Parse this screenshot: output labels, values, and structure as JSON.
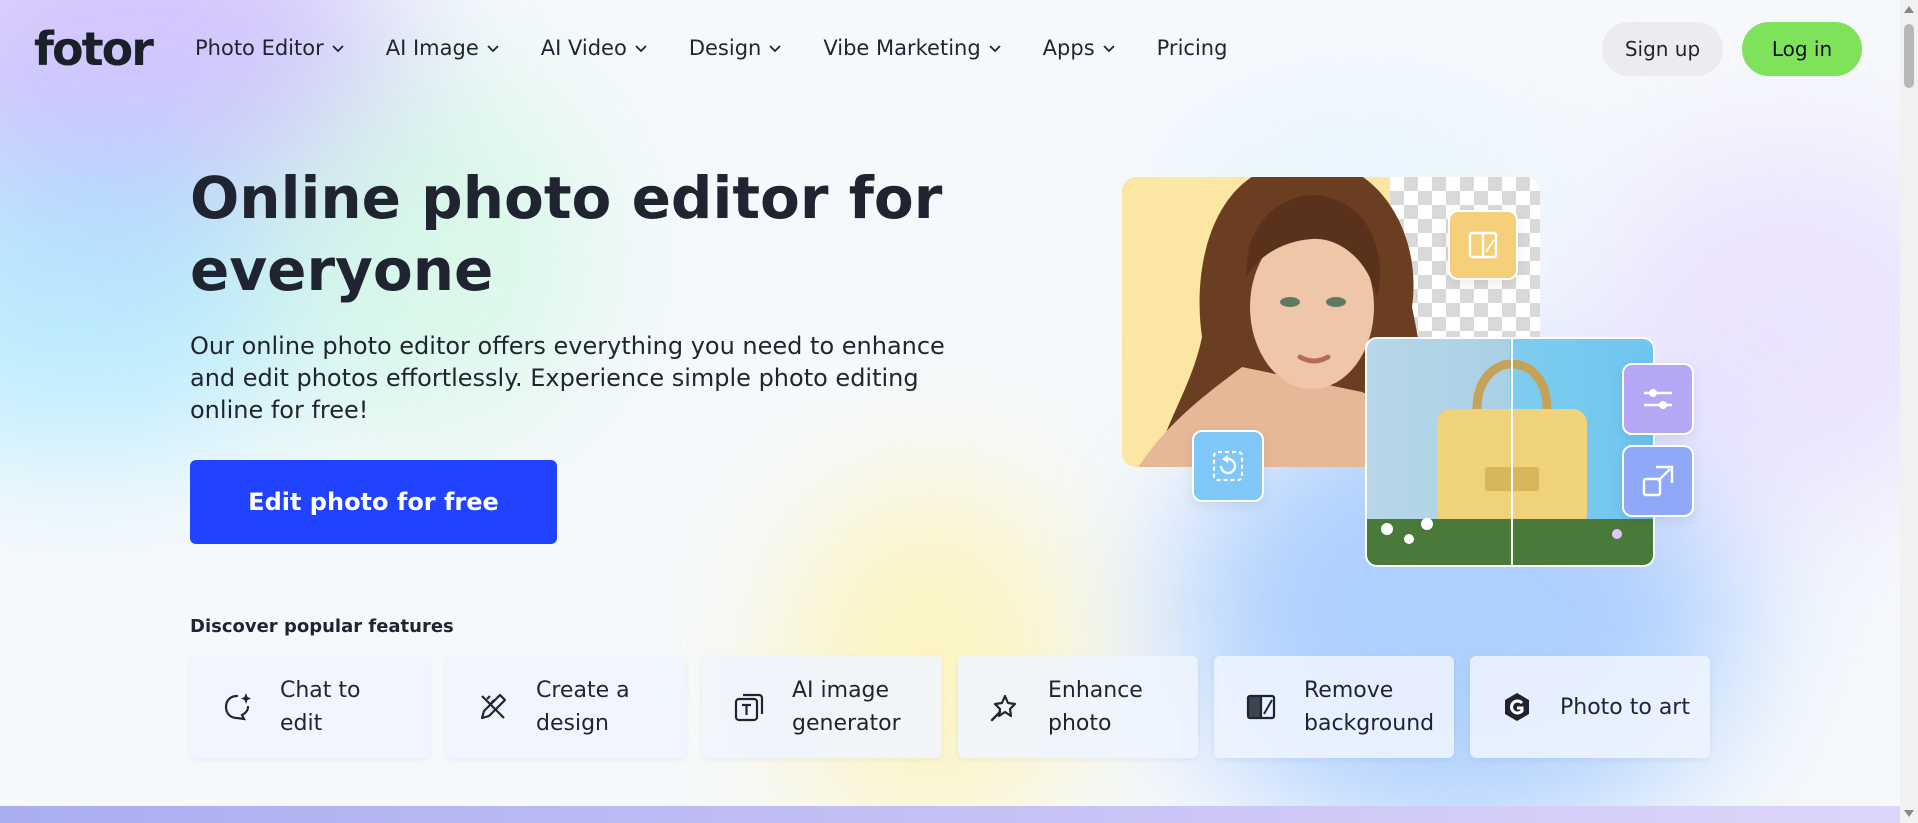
{
  "brand": {
    "logo": "fotor"
  },
  "nav": {
    "items": [
      {
        "label": "Photo Editor",
        "has_dropdown": true
      },
      {
        "label": "AI Image",
        "has_dropdown": true
      },
      {
        "label": "AI Video",
        "has_dropdown": true
      },
      {
        "label": "Design",
        "has_dropdown": true
      },
      {
        "label": "Vibe Marketing",
        "has_dropdown": true
      },
      {
        "label": "Apps",
        "has_dropdown": true
      },
      {
        "label": "Pricing",
        "has_dropdown": false
      }
    ],
    "signup_label": "Sign up",
    "login_label": "Log in"
  },
  "hero": {
    "title": "Online photo editor for everyone",
    "subtitle": "Our online photo editor offers everything you need to enhance and edit photos effortlessly. Experience simple photo editing online for free!",
    "cta_label": "Edit photo for free"
  },
  "features": {
    "label": "Discover popular features",
    "items": [
      {
        "label": "Chat to edit",
        "icon": "chat-sparkle-icon"
      },
      {
        "label": "Create a design",
        "icon": "pencil-ruler-icon"
      },
      {
        "label": "AI image generator",
        "icon": "ai-text-image-icon"
      },
      {
        "label": "Enhance photo",
        "icon": "magic-star-icon"
      },
      {
        "label": "Remove background",
        "icon": "remove-bg-icon"
      },
      {
        "label": "Photo to art",
        "icon": "art-g-icon"
      }
    ]
  },
  "colors": {
    "cta": "#2142ff",
    "login": "#7ee25a",
    "signup": "#ececef",
    "text": "#1f2430"
  }
}
